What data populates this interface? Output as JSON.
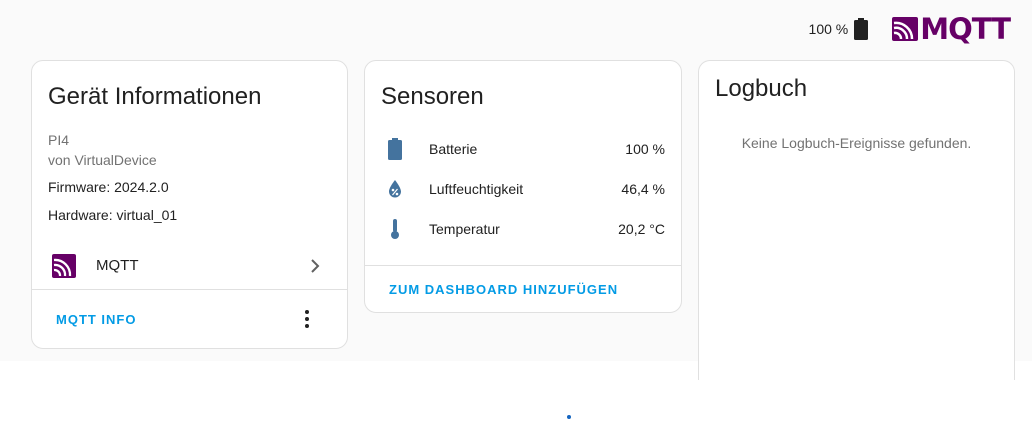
{
  "header": {
    "battery_text": "100 %",
    "battery_icon": "battery-icon",
    "brand_text": "MQTT",
    "brand_color": "#660066"
  },
  "device_card": {
    "title": "Gerät Informationen",
    "model": "PI4",
    "manufacturer": "von VirtualDevice",
    "firmware": "Firmware: 2024.2.0",
    "hardware": "Hardware: virtual_01",
    "integration": {
      "label": "MQTT",
      "icon": "mqtt-icon"
    },
    "action_label": "MQTT INFO",
    "menu_icon": "more-vertical-icon"
  },
  "sensors_card": {
    "title": "Sensoren",
    "sensors": [
      {
        "name": "Batterie",
        "value": "100 %",
        "icon": "battery-icon"
      },
      {
        "name": "Luftfeuchtigkeit",
        "value": "46,4 %",
        "icon": "humidity-icon"
      },
      {
        "name": "Temperatur",
        "value": "20,2 °C",
        "icon": "thermometer-icon"
      }
    ],
    "action_label": "ZUM DASHBOARD HINZUFÜGEN"
  },
  "logbook_card": {
    "title": "Logbuch",
    "empty_text": "Keine Logbuch-Ereignisse gefunden."
  },
  "colors": {
    "accent": "#039be5",
    "icon_blue": "#44739e",
    "mqtt_purple": "#660066"
  }
}
